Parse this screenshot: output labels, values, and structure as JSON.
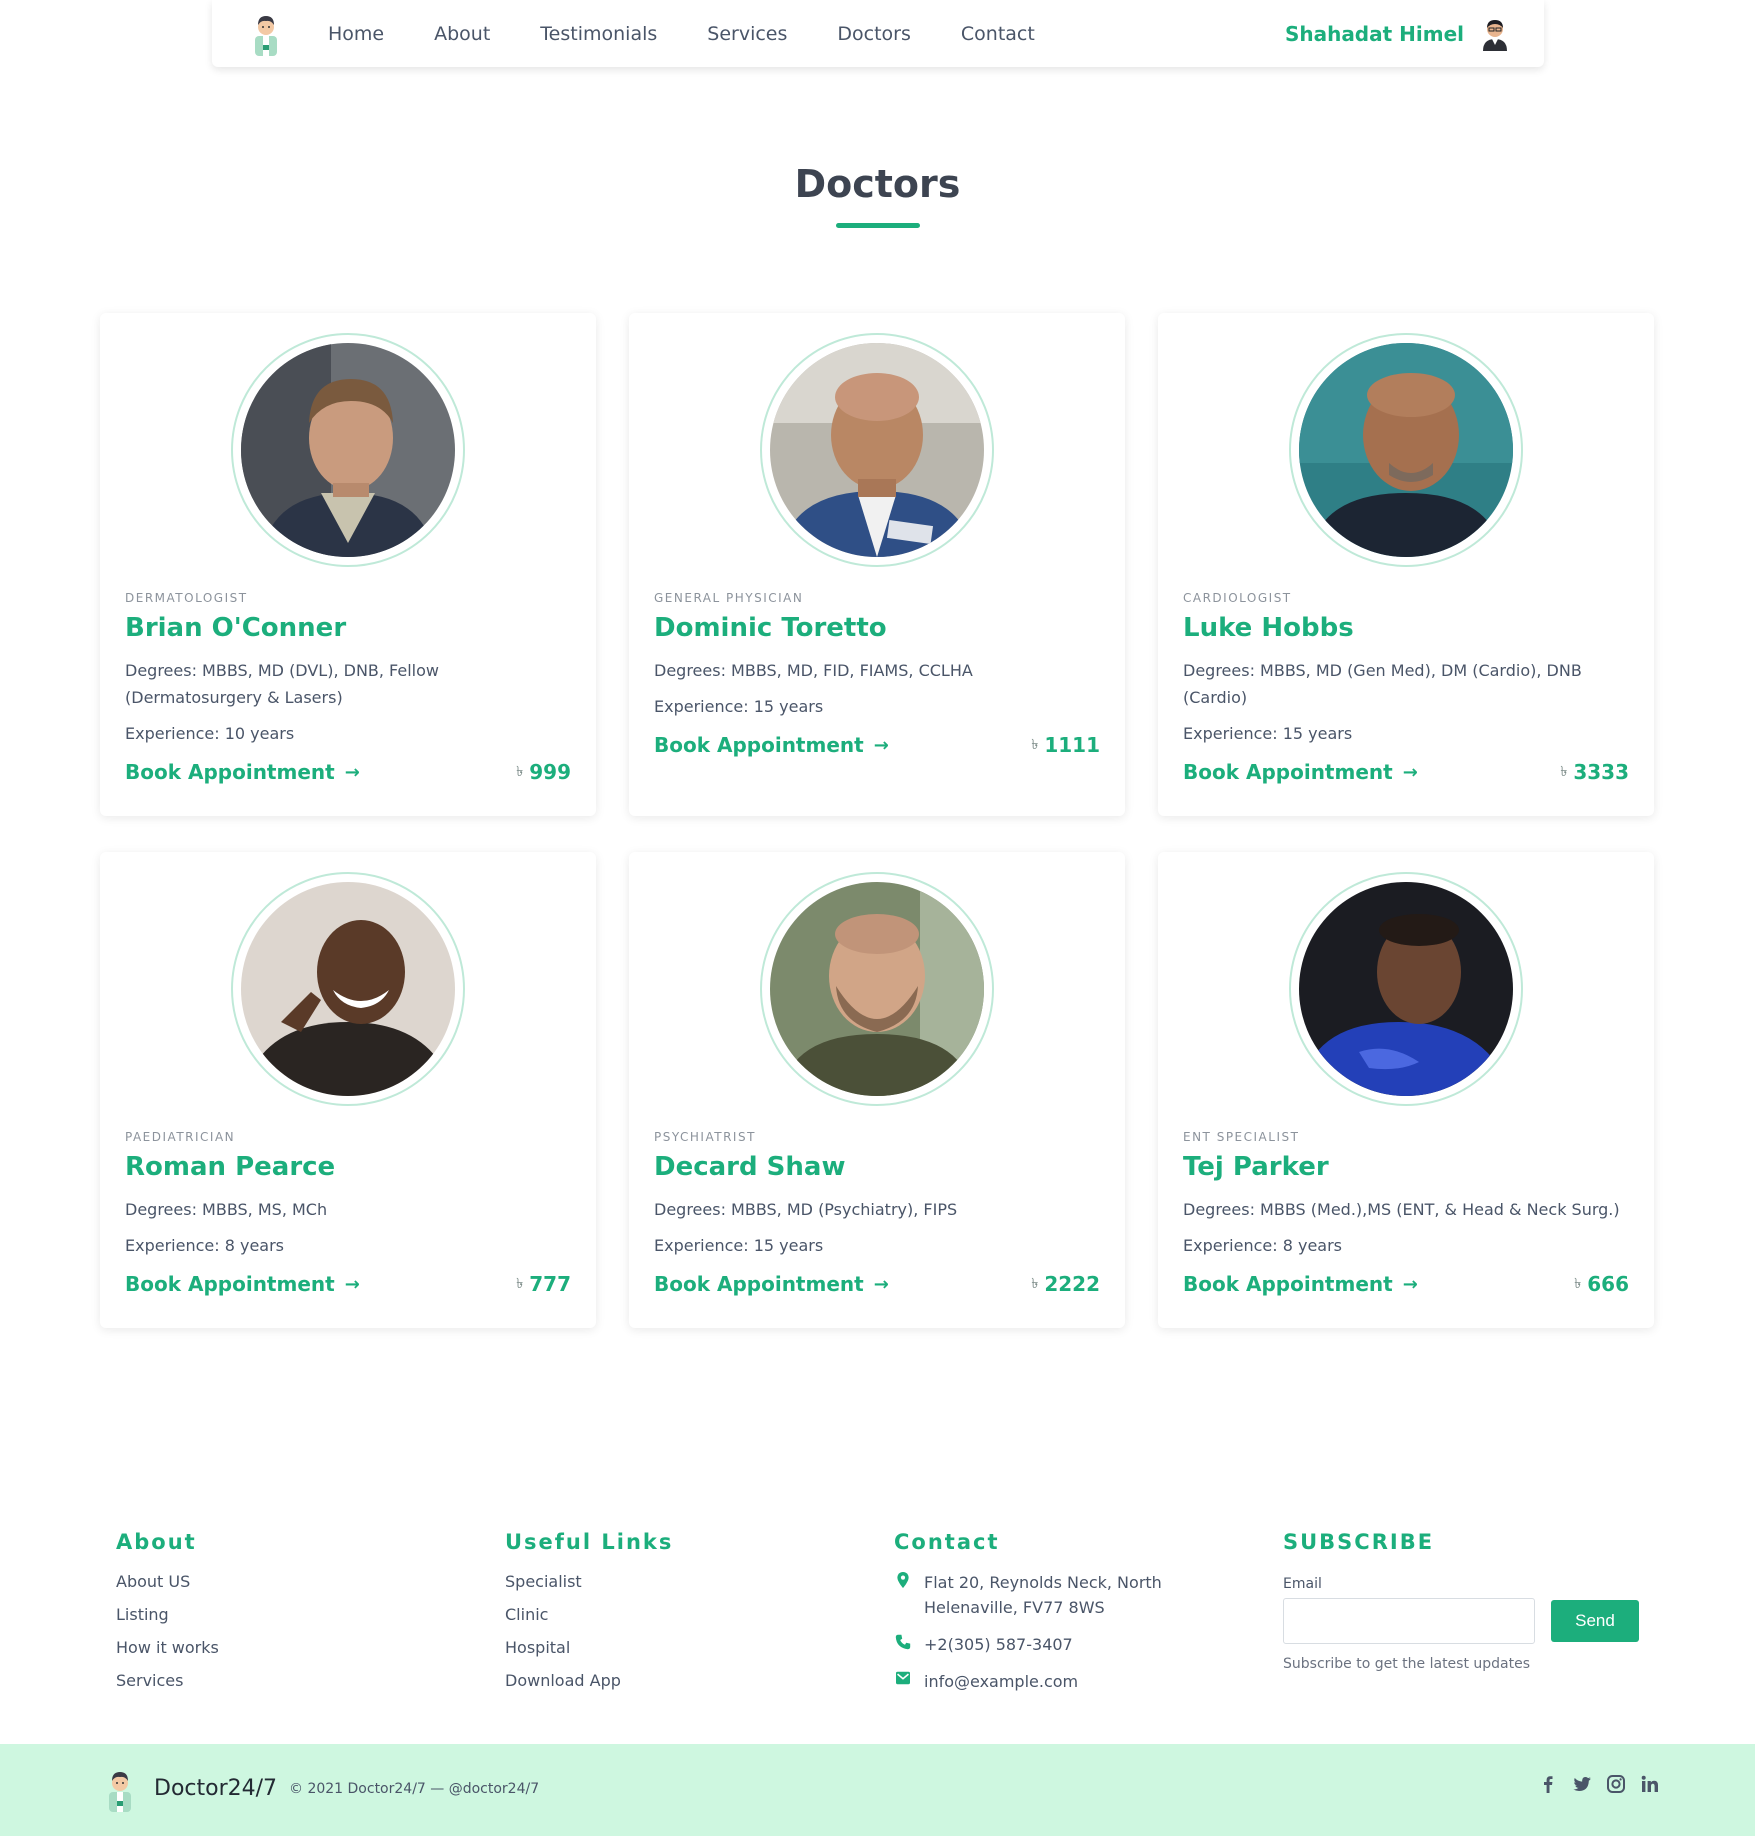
{
  "nav": {
    "links": [
      "Home",
      "About",
      "Testimonials",
      "Services",
      "Doctors",
      "Contact"
    ],
    "user_name": "Shahadat Himel"
  },
  "section": {
    "title": "Doctors"
  },
  "doctors": [
    {
      "specialty": "DERMATOLOGIST",
      "name": "Brian O'Conner",
      "degrees": "Degrees: MBBS, MD (DVL), DNB, Fellow (Dermatosurgery & Lasers)",
      "experience": "Experience: 10 years",
      "book_label": "Book Appointment",
      "price": "999"
    },
    {
      "specialty": "GENERAL PHYSICIAN",
      "name": "Dominic Toretto",
      "degrees": "Degrees: MBBS, MD, FID, FIAMS, CCLHA",
      "experience": "Experience: 15 years",
      "book_label": "Book Appointment",
      "price": "1111"
    },
    {
      "specialty": "CARDIOLOGIST",
      "name": "Luke Hobbs",
      "degrees": "Degrees: MBBS, MD (Gen Med), DM (Cardio), DNB (Cardio)",
      "experience": "Experience: 15 years",
      "book_label": "Book Appointment",
      "price": "3333"
    },
    {
      "specialty": "PAEDIATRICIAN",
      "name": "Roman Pearce",
      "degrees": "Degrees: MBBS, MS, MCh",
      "experience": "Experience: 8 years",
      "book_label": "Book Appointment",
      "price": "777"
    },
    {
      "specialty": "PSYCHIATRIST",
      "name": "Decard Shaw",
      "degrees": "Degrees: MBBS, MD (Psychiatry), FIPS",
      "experience": "Experience: 15 years",
      "book_label": "Book Appointment",
      "price": "2222"
    },
    {
      "specialty": "ENT SPECIALIST",
      "name": "Tej Parker",
      "degrees": "Degrees: MBBS (Med.),MS (ENT, & Head & Neck Surg.)",
      "experience": "Experience: 8 years",
      "book_label": "Book Appointment",
      "price": "666"
    }
  ],
  "footer": {
    "about": {
      "heading": "About",
      "items": [
        "About US",
        "Listing",
        "How it works",
        "Services"
      ]
    },
    "useful": {
      "heading": "Useful Links",
      "items": [
        "Specialist",
        "Clinic",
        "Hospital",
        "Download App"
      ]
    },
    "contact": {
      "heading": "Contact",
      "address": "Flat 20, Reynolds Neck, North Helenaville, FV77 8WS",
      "phone": "+2(305) 587-3407",
      "email": "info@example.com"
    },
    "subscribe": {
      "heading": "SUBSCRIBE",
      "email_label": "Email",
      "button": "Send",
      "note": "Subscribe to get the latest updates"
    }
  },
  "bottom_bar": {
    "brand": "Doctor24/7",
    "copyright": "© 2021 Doctor24/7 — @doctor24/7"
  },
  "colors": {
    "accent": "#1cae7c",
    "bottom_bar": "#cef7e0",
    "text": "#4a5568"
  },
  "icons": [
    "doctor-logo-icon",
    "user-avatar",
    "arrow-right-icon",
    "taka-icon",
    "map-pin-icon",
    "phone-icon",
    "mail-icon",
    "facebook-icon",
    "twitter-icon",
    "instagram-icon",
    "linkedin-icon"
  ]
}
